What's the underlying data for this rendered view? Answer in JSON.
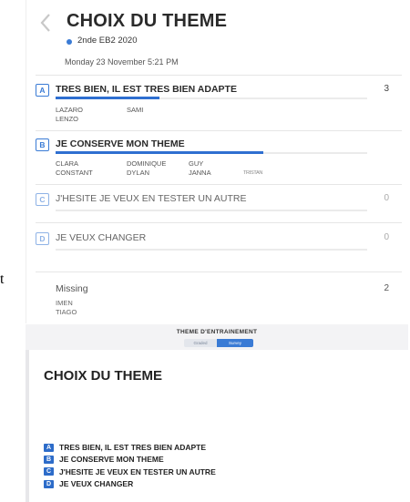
{
  "stray_text": "t",
  "header": {
    "title": "CHOIX DU THEME",
    "class_name": "2nde EB2 2020",
    "datetime": "Monday 23 November 5:21 PM"
  },
  "options": [
    {
      "letter": "A",
      "label": "TRES BIEN, IL EST TRES BIEN ADAPTE",
      "count": "3",
      "share": 0.333,
      "names": [
        "LAZARO",
        "SAMI",
        "LENZO"
      ]
    },
    {
      "letter": "B",
      "label": "JE CONSERVE MON THEME",
      "count": "",
      "share": 0.667,
      "names": [
        "CLARA",
        "DOMINIQUE",
        "GUY",
        "CONSTANT",
        "DYLAN",
        "JANNA",
        "TRISTAN"
      ]
    },
    {
      "letter": "C",
      "label": "J'HESITE JE VEUX EN TESTER UN AUTRE",
      "count": "0",
      "share": 0
    },
    {
      "letter": "D",
      "label": "JE VEUX CHANGER",
      "count": "0",
      "share": 0
    }
  ],
  "missing": {
    "label": "Missing",
    "count": "2",
    "names": [
      "IMEN",
      "TIAGO"
    ]
  },
  "strip": {
    "title": "THEME D'ENTRAINEMENT",
    "toggle_left": "Graded",
    "toggle_right": "Survey"
  },
  "slide": {
    "title": "CHOIX DU THEME",
    "items": [
      {
        "letter": "A",
        "label": "TRES BIEN,  IL EST TRES BIEN ADAPTE"
      },
      {
        "letter": "B",
        "label": "JE CONSERVE MON THEME"
      },
      {
        "letter": "C",
        "label": "J'HESITE JE VEUX EN TESTER UN AUTRE"
      },
      {
        "letter": "D",
        "label": "JE VEUX CHANGER"
      }
    ]
  },
  "colors": {
    "accent": "#3a7bd5",
    "bar": "#2f6fd0"
  }
}
